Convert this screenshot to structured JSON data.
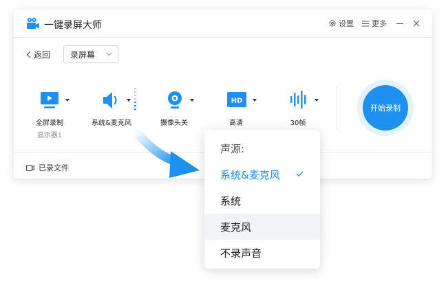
{
  "app": {
    "title": "一键录屏大师"
  },
  "titlebar": {
    "settings_label": "设置",
    "more_label": "更多"
  },
  "toolbar": {
    "back_label": "返回",
    "mode_value": "录屏幕"
  },
  "tools": [
    {
      "label": "全屏录制",
      "sub": "显示器1"
    },
    {
      "label": "系统&麦克风"
    },
    {
      "label": "摄像头关"
    },
    {
      "label": "高清",
      "badge": "HD"
    },
    {
      "label": "30帧"
    }
  ],
  "start_button": {
    "label": "开始录制"
  },
  "footer": {
    "recorded_label": "已录文件"
  },
  "audio_menu": {
    "title": "声源:",
    "items": [
      {
        "label": "系统&麦克风",
        "selected": true
      },
      {
        "label": "系统"
      },
      {
        "label": "麦克风",
        "hovered": true
      },
      {
        "label": "不录声音"
      }
    ]
  },
  "colors": {
    "accent": "#1e90f0",
    "selected_text": "#1e8ff0",
    "hover_bg": "#f1f3f6"
  }
}
